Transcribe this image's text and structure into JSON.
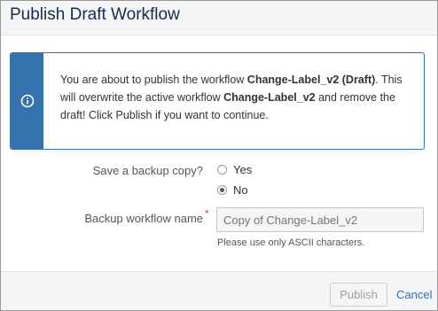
{
  "dialog": {
    "title": "Publish Draft Workflow"
  },
  "info": {
    "icon": "info-icon",
    "text_1": "You are about to publish the workflow ",
    "workflow_name": "Change-Label_v2 (Draft)",
    "text_2": ". This will overwrite the active workflow ",
    "active_workflow": "Change-Label_v2",
    "text_3": " and remove the draft! Click Publish if you want to continue.",
    "accent_color": "#3572b0"
  },
  "form": {
    "backup_label": "Save a backup copy?",
    "options": [
      {
        "label": "Yes",
        "checked": false
      },
      {
        "label": "No",
        "checked": true
      }
    ],
    "name_label": "Backup workflow name",
    "required_mark": "*",
    "name_placeholder": "Copy of Change-Label_v2",
    "hint": "Please use only ASCII characters."
  },
  "footer": {
    "publish_label": "Publish",
    "cancel_label": "Cancel"
  }
}
